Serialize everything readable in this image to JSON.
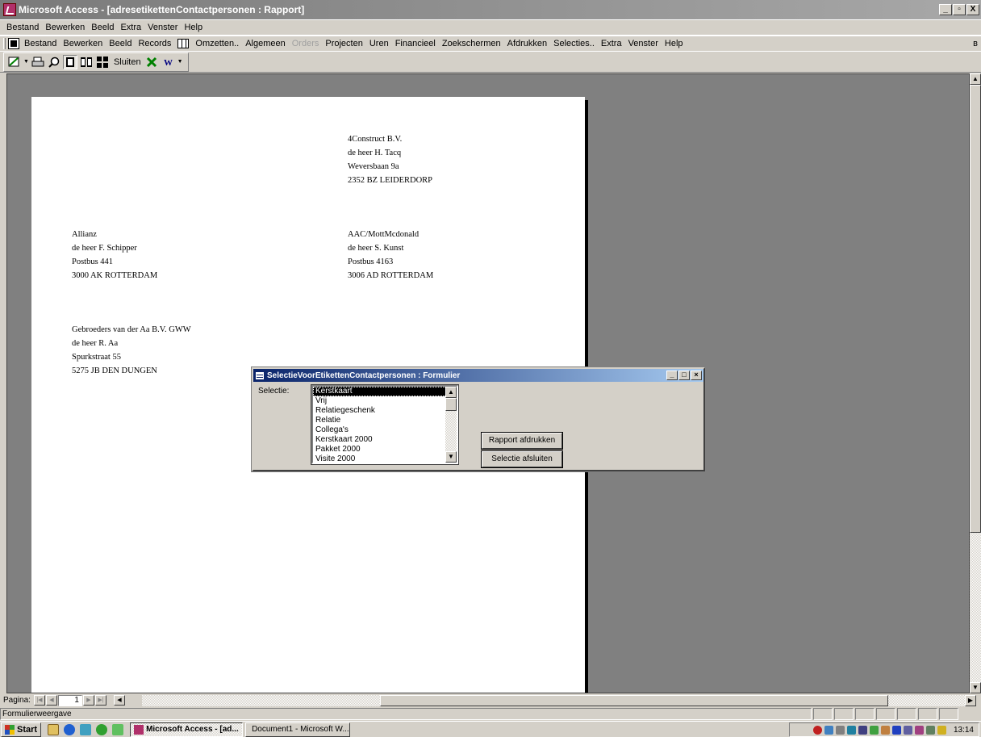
{
  "window": {
    "title": "Microsoft Access - [adresetikettenContactpersonen : Rapport]",
    "buttons": [
      "_",
      "в",
      "X"
    ]
  },
  "menubar1": {
    "items": [
      "Bestand",
      "Bewerken",
      "Beeld",
      "Extra",
      "Venster",
      "Help"
    ]
  },
  "menubar2": {
    "items": [
      {
        "label": "Bestand"
      },
      {
        "label": "Bewerken"
      },
      {
        "label": "Beeld"
      },
      {
        "label": "Records"
      }
    ],
    "items_after": [
      {
        "label": "Omzetten..",
        "disabled": false
      },
      {
        "label": "Algemeen",
        "disabled": false
      },
      {
        "label": "Orders",
        "disabled": true
      },
      {
        "label": "Projecten",
        "disabled": false
      },
      {
        "label": "Uren",
        "disabled": false
      },
      {
        "label": "Financieel",
        "disabled": false
      },
      {
        "label": "Zoekschermen",
        "disabled": false
      },
      {
        "label": "Afdrukken",
        "disabled": false
      },
      {
        "label": "Selecties..",
        "disabled": false
      },
      {
        "label": "Extra",
        "disabled": false
      },
      {
        "label": "Venster",
        "disabled": false
      },
      {
        "label": "Help",
        "disabled": false
      }
    ],
    "restore": "в"
  },
  "toolbar": {
    "close_label": "Sluiten"
  },
  "labels": [
    {
      "lines": [
        "4Construct B.V.",
        "de heer H. Tacq",
        "Weversbaan 9a",
        "2352 BZ LEIDERDORP"
      ]
    },
    {
      "lines": [
        "Allianz",
        "de heer F. Schipper",
        "Postbus 441",
        "3000 AK ROTTERDAM"
      ]
    },
    {
      "lines": [
        "AAC/MottMcdonald",
        "de heer S. Kunst",
        "Postbus 4163",
        "3006 AD ROTTERDAM"
      ]
    },
    {
      "lines": [
        "Gebroeders van der Aa B.V. GWW",
        "de heer R. Aa",
        "Spurkstraat 55",
        "5275 JB DEN DUNGEN"
      ]
    }
  ],
  "navigation": {
    "label": "Pagina:",
    "page": "1"
  },
  "status": {
    "text": "Formulierweergave"
  },
  "dialog": {
    "title": "SelectieVoorEtikettenContactpersonen : Formulier",
    "selection_label": "Selectie:",
    "options": [
      "Kerstkaart",
      "Vrij",
      "Relatiegeschenk",
      "Relatie",
      "Collega's",
      "Kerstkaart 2000",
      "Pakket 2000",
      "Visite 2000"
    ],
    "selected_index": 0,
    "print_button": "Rapport afdrukken",
    "close_button": "Selectie afsluiten"
  },
  "taskbar": {
    "start_label": "Start",
    "tasks": [
      {
        "label": "Microsoft Access - [ad...",
        "active": true
      },
      {
        "label": "Document1 - Microsoft W...",
        "active": false
      }
    ],
    "clock": "13:14"
  }
}
